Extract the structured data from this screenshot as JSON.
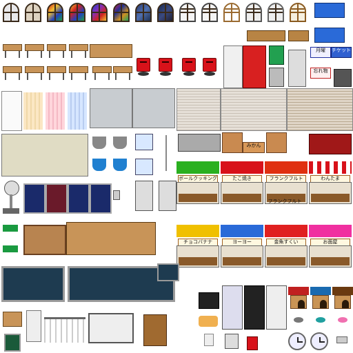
{
  "sheet": {
    "signs": {
      "month_sign": "月曜",
      "ticket_sign": "チケット販売",
      "lost_sign": "忘れ物",
      "shop1": "ボールクッキング",
      "shop2": "たこ焼き",
      "shop3": "フランクフルト",
      "shop4": "わんたま",
      "frank_sign": "フランクフルト",
      "choco_banana": "チョコバナナ",
      "shop6": "ヨーヨー",
      "shop7": "金魚すくい",
      "shop8": "お面屋",
      "box_label": "みかん"
    },
    "colors": {
      "red": "#d8121a",
      "blue": "#2a6ad8",
      "wood": "#c89458",
      "green": "#2ab020",
      "yellow": "#f0c000",
      "pink": "#f030a0"
    }
  }
}
